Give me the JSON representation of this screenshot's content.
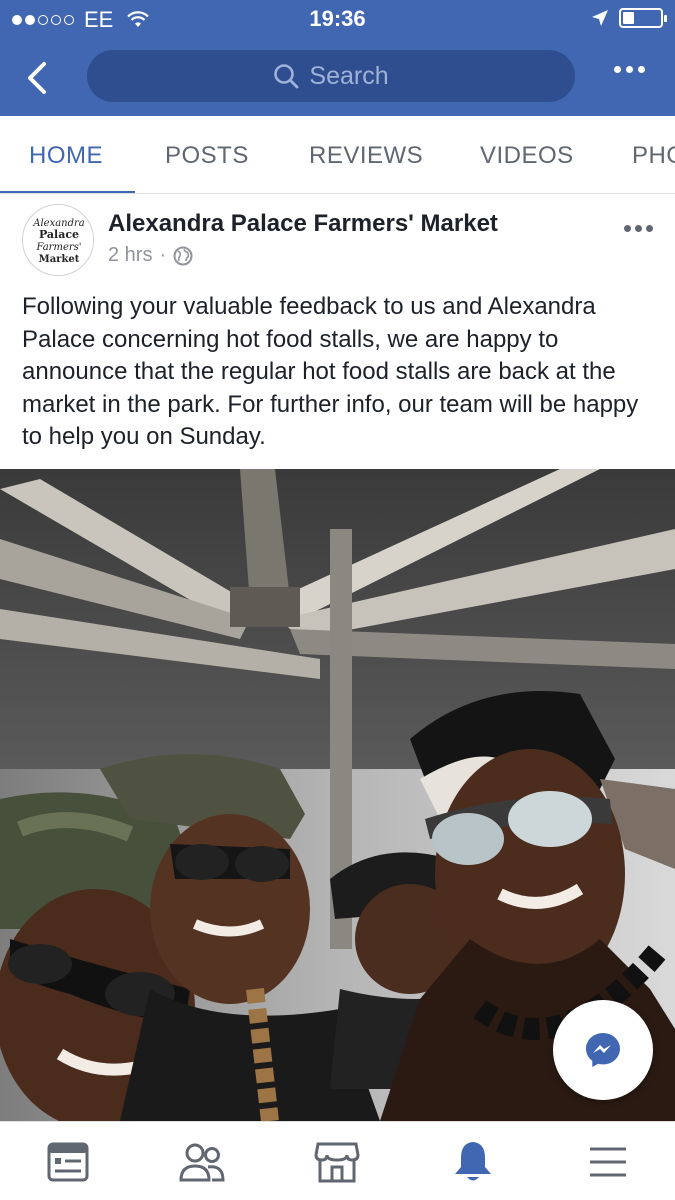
{
  "status_bar": {
    "carrier": "EE",
    "time": "19:36",
    "battery_level": 0.3
  },
  "header": {
    "search_placeholder": "Search",
    "icons": [
      "back-icon",
      "search-icon",
      "more-icon"
    ]
  },
  "tabs": [
    {
      "label": "HOME",
      "active": true
    },
    {
      "label": "POSTS",
      "active": false
    },
    {
      "label": "REVIEWS",
      "active": false
    },
    {
      "label": "VIDEOS",
      "active": false
    },
    {
      "label": "PHO",
      "active": false
    }
  ],
  "post": {
    "page_name": "Alexandra Palace Farmers' Market",
    "avatar_text": [
      "Alexandra",
      "Palace",
      "Farmers'",
      "Market"
    ],
    "time_ago": "2 hrs",
    "separator": "·",
    "audience_icon": "globe-icon",
    "text": "Following your valuable feedback to us and Alexandra Palace concerning hot food stalls, we are happy to announce that the regular hot food stalls are back at the market in the park. For further info, our team will be happy to help you on Sunday."
  },
  "photo": {
    "description_icon": "photo"
  },
  "bottom_nav": {
    "items": [
      "news-feed-icon",
      "friends-icon",
      "marketplace-icon",
      "notifications-icon",
      "menu-icon"
    ],
    "active": "notifications-icon"
  },
  "colors": {
    "brand": "#4267b2",
    "search_bg": "#2f4e8f",
    "text": "#1d2129",
    "secondary": "#90949c"
  }
}
